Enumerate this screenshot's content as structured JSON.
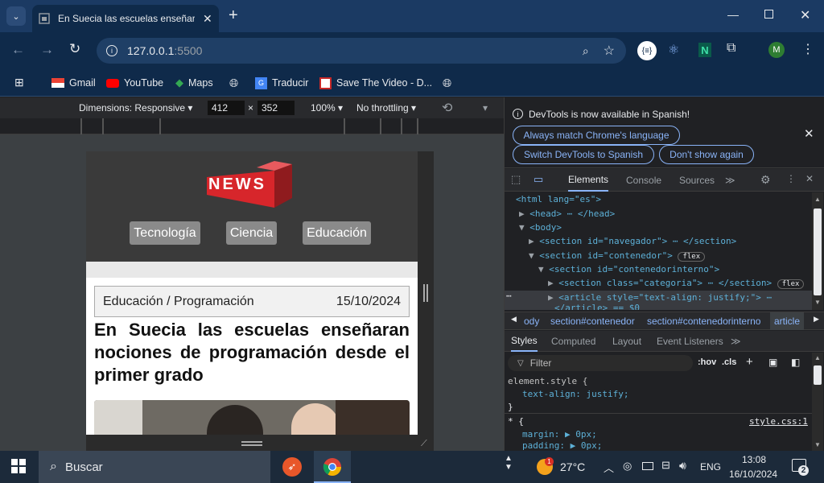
{
  "browser": {
    "tab_title": "En Suecia las escuelas enseñara",
    "url_host": "127.0.0.1",
    "url_port": ":5500",
    "bookmarks": [
      "Gmail",
      "YouTube",
      "Maps",
      "Traducir",
      "Save The Video - D..."
    ]
  },
  "device_toolbar": {
    "dimensions_label": "Dimensions: Responsive",
    "width": "412",
    "x_sep": "×",
    "height": "352",
    "zoom": "100%",
    "throttling": "No throttling"
  },
  "page": {
    "logo_text": "NEWS",
    "nav": [
      "Tecnología",
      "Ciencia",
      "Educación"
    ],
    "breadcrumb": "Educación / Programación",
    "date": "15/10/2024",
    "headline": "En Suecia las escuelas enseñaran nociones de programación desde el primer grado"
  },
  "devtools": {
    "banner": "DevTools is now available in Spanish!",
    "btn_match": "Always match Chrome's language",
    "btn_switch": "Switch DevTools to Spanish",
    "btn_dont": "Don't show again",
    "tabs": [
      "Elements",
      "Console",
      "Sources"
    ],
    "dom": [
      "<html lang=\"es\">",
      "<head> ⋯ </head>",
      "<body>",
      "<section id=\"navegador\"> ⋯ </section>",
      "<section id=\"contenedor\">",
      "<section id=\"contenedorinterno\">",
      "<section class=\"categoria\"> ⋯ </section>",
      "<article style=\"text-align: justify;\"> ⋯",
      "</article> == $0"
    ],
    "flex_badge": "flex",
    "crumbs": [
      "ody",
      "section#contenedor",
      "section#contenedorinterno",
      "article"
    ],
    "style_tabs": [
      "Styles",
      "Computed",
      "Layout",
      "Event Listeners"
    ],
    "filter_placeholder": "Filter",
    "hov": ":hov",
    "cls": ".cls",
    "css_rules": [
      "element.style {",
      "text-align: justify;",
      "}",
      "* {",
      "margin: ▶ 0px;",
      "padding: ▶ 0px;"
    ],
    "css_source": "style.css:1"
  },
  "taskbar": {
    "search": "Buscar",
    "weather": "27°C",
    "lang": "ENG",
    "time": "13:08",
    "date": "16/10/2024",
    "notif_count": "2",
    "weather_badge": "1"
  },
  "colors": {
    "accent_blue": "#8ab4f8",
    "logo_red": "#d7262b",
    "nav_button": "#8a8a8a",
    "header_dark": "#3a3a3a"
  }
}
